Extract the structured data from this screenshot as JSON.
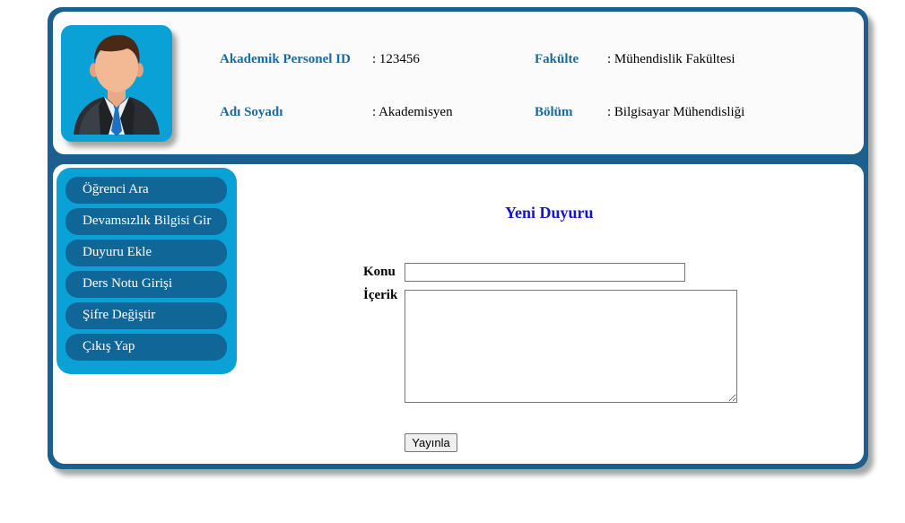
{
  "header": {
    "personnel_id_label": "Akademik Personel ID",
    "personnel_id_value": ": 123456",
    "name_label": "Adı Soyadı",
    "name_value": ": Akademisyen",
    "faculty_label": "Fakülte",
    "faculty_value": ": Mühendislik Fakültesi",
    "department_label": "Bölüm",
    "department_value": ": Bilgisayar Mühendisliği",
    "avatar_icon": "businessman-avatar-icon"
  },
  "menu": {
    "items": [
      {
        "label": "Öğrenci Ara"
      },
      {
        "label": "Devamsızlık Bilgisi Gir"
      },
      {
        "label": "Duyuru Ekle"
      },
      {
        "label": "Ders Notu Girişi"
      },
      {
        "label": "Şifre Değiştir"
      },
      {
        "label": "Çıkış Yap"
      }
    ]
  },
  "form": {
    "title": "Yeni Duyuru",
    "konu_label": "Konu",
    "konu_value": "",
    "icerik_label": "İçerik",
    "icerik_value": "",
    "submit_label": "Yayınla"
  },
  "colors": {
    "frame": "#1b5f8e",
    "accent": "#0aa2d6",
    "menu_item": "#116698",
    "label": "#1a6aa0",
    "title": "#1515cc"
  }
}
